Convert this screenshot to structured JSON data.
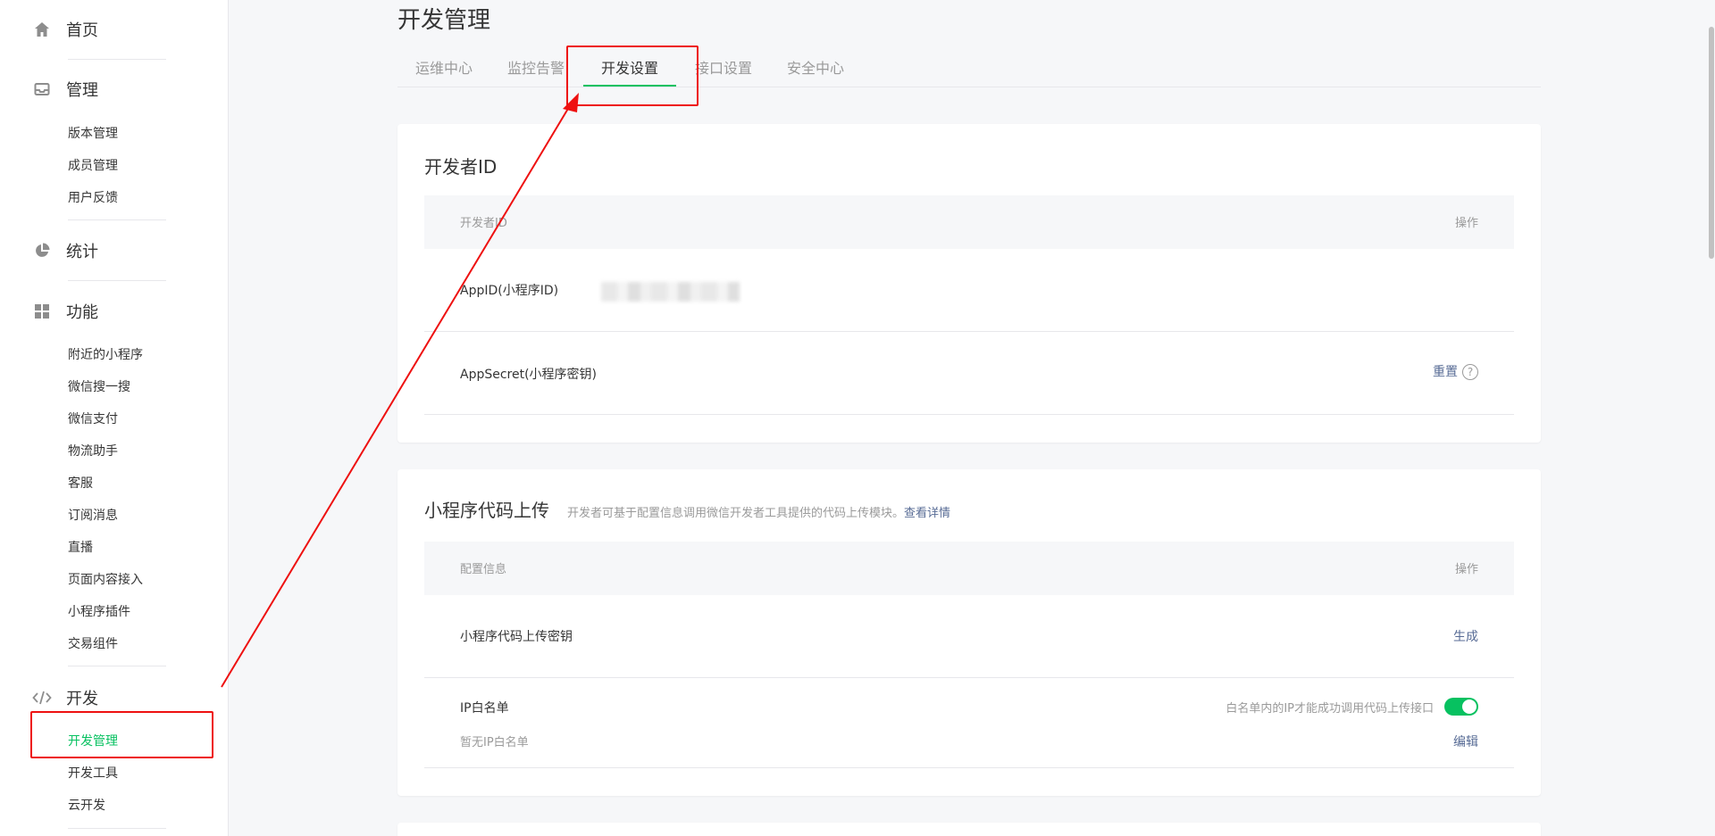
{
  "sidebar": {
    "home": "首页",
    "manage": {
      "title": "管理",
      "items": [
        "版本管理",
        "成员管理",
        "用户反馈"
      ]
    },
    "stats": "统计",
    "features": {
      "title": "功能",
      "items": [
        "附近的小程序",
        "微信搜一搜",
        "微信支付",
        "物流助手",
        "客服",
        "订阅消息",
        "直播",
        "页面内容接入",
        "小程序插件",
        "交易组件"
      ]
    },
    "dev": {
      "title": "开发",
      "items": [
        "开发管理",
        "开发工具",
        "云开发"
      ]
    }
  },
  "page_title": "开发管理",
  "tabs": [
    "运维中心",
    "监控告警",
    "开发设置",
    "接口设置",
    "安全中心"
  ],
  "developer_id": {
    "title": "开发者ID",
    "col_id": "开发者ID",
    "col_op": "操作",
    "appid_label": "AppID(小程序ID)",
    "secret_label": "AppSecret(小程序密钥)",
    "reset": "重置",
    "help": "?"
  },
  "code_upload": {
    "title": "小程序代码上传",
    "desc": "开发者可基于配置信息调用微信开发者工具提供的代码上传模块。",
    "desc_link": "查看详情",
    "col_config": "配置信息",
    "col_op": "操作",
    "key_label": "小程序代码上传密钥",
    "generate": "生成",
    "ip_label": "IP白名单",
    "ip_empty": "暂无IP白名单",
    "ip_hint": "白名单内的IP才能成功调用代码上传接口",
    "edit": "编辑"
  },
  "colors": {
    "accent": "#07c160",
    "link": "#576b95",
    "annotation": "#ee1111"
  }
}
